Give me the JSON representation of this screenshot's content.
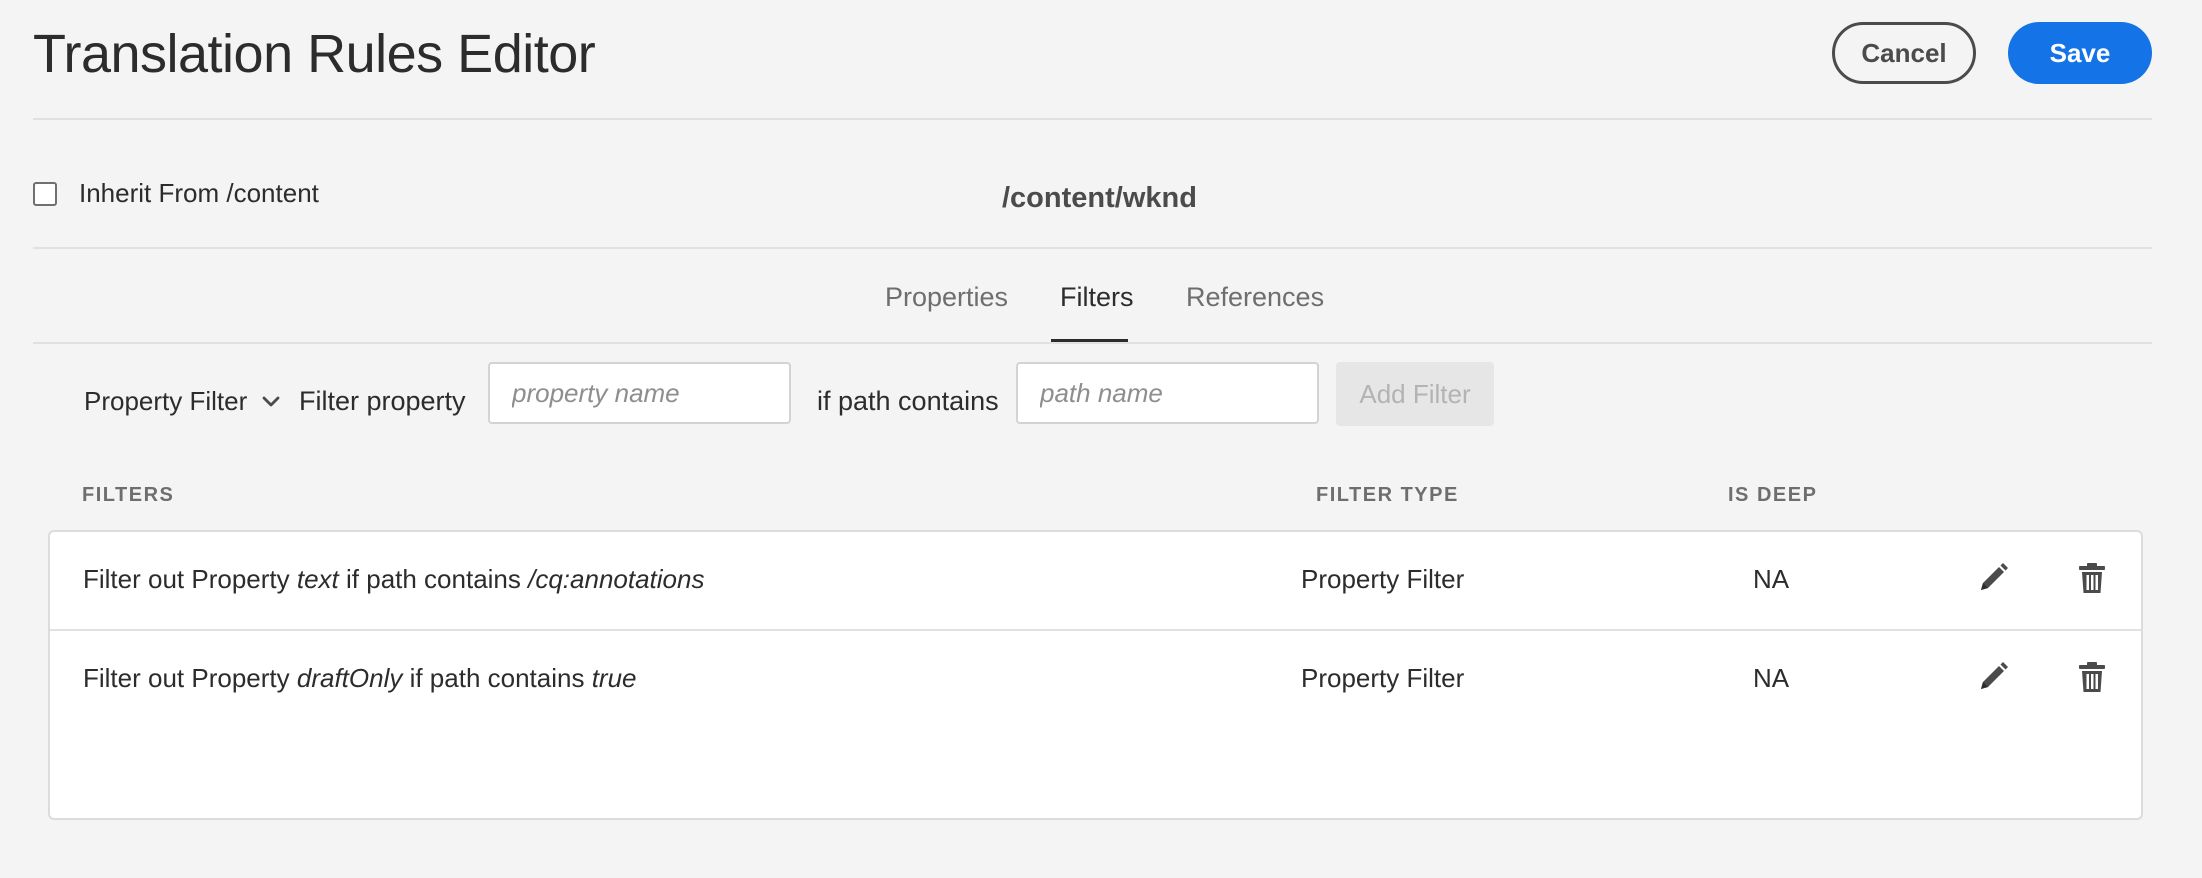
{
  "header": {
    "title": "Translation Rules Editor",
    "cancel_label": "Cancel",
    "save_label": "Save"
  },
  "inherit": {
    "label": "Inherit From /content",
    "checked": false
  },
  "path_title": "/content/wknd",
  "tabs": [
    {
      "label": "Properties",
      "active": false
    },
    {
      "label": "Filters",
      "active": true
    },
    {
      "label": "References",
      "active": false
    }
  ],
  "filter_bar": {
    "type_selected": "Property Filter",
    "filter_property_label": "Filter property",
    "property_placeholder": "property name",
    "if_path_contains_label": "if path contains",
    "path_placeholder": "path name",
    "add_filter_label": "Add Filter"
  },
  "table": {
    "headers": [
      "FILTERS",
      "FILTER TYPE",
      "IS DEEP"
    ],
    "rows": [
      {
        "prefix": "Filter out Property ",
        "property": "text",
        "middle": " if path contains ",
        "path": "/cq:annotations",
        "type": "Property Filter",
        "is_deep": "NA"
      },
      {
        "prefix": "Filter out Property ",
        "property": "draftOnly",
        "middle": " if path contains ",
        "path": "true",
        "type": "Property Filter",
        "is_deep": "NA"
      }
    ]
  },
  "colors": {
    "accent": "#1473e6",
    "background": "#f4f4f4"
  },
  "icons": [
    "chevron-down-icon",
    "pencil-icon",
    "trash-icon"
  ]
}
